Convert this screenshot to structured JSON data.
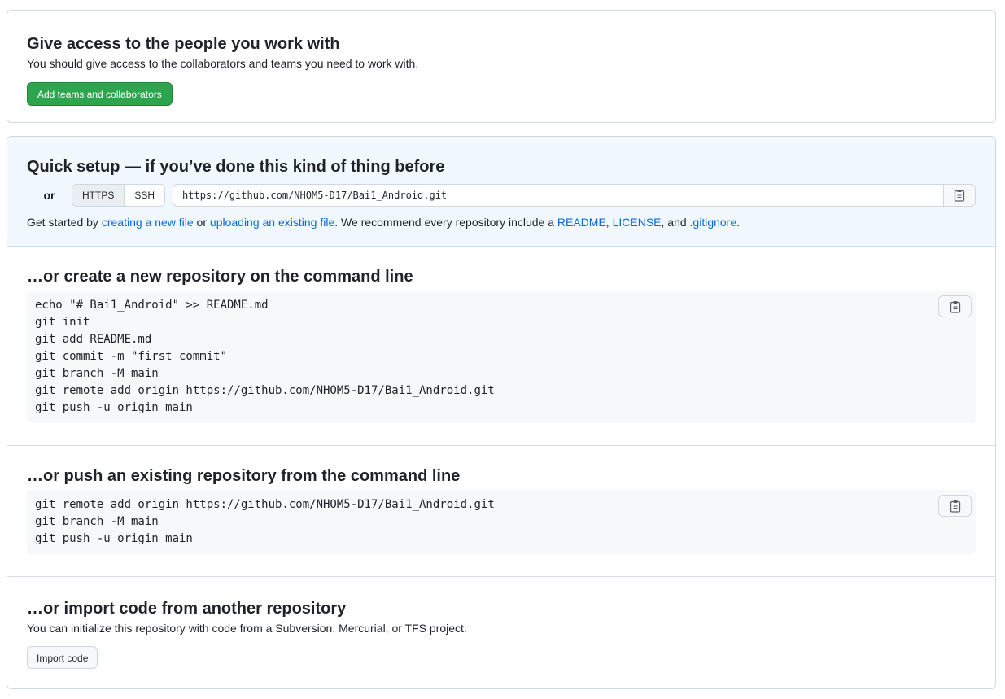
{
  "access": {
    "title": "Give access to the people you work with",
    "description": "You should give access to the collaborators and teams you need to work with.",
    "button_label": "Add teams and collaborators"
  },
  "quick_setup": {
    "title": "Quick setup — if you’ve done this kind of thing before",
    "or_label": "or",
    "protocols": [
      {
        "label": "HTTPS",
        "selected": true
      },
      {
        "label": "SSH",
        "selected": false
      }
    ],
    "clone_url": "https://github.com/NHOM5-D17/Bai1_Android.git",
    "copy_icon": "clipboard-icon",
    "get_started": {
      "prefix": "Get started by ",
      "link_new_file": "creating a new file",
      "or_text": " or ",
      "link_upload": "uploading an existing file",
      "middle": ". We recommend every repository include a ",
      "link_readme": "README",
      "comma": ", ",
      "link_license": "LICENSE",
      "and_text": ", and ",
      "link_gitignore": ".gitignore",
      "suffix": "."
    }
  },
  "create_repo": {
    "title": "…or create a new repository on the command line",
    "code": "echo \"# Bai1_Android\" >> README.md\ngit init\ngit add README.md\ngit commit -m \"first commit\"\ngit branch -M main\ngit remote add origin https://github.com/NHOM5-D17/Bai1_Android.git\ngit push -u origin main"
  },
  "push_repo": {
    "title": "…or push an existing repository from the command line",
    "code": "git remote add origin https://github.com/NHOM5-D17/Bai1_Android.git\ngit branch -M main\ngit push -u origin main"
  },
  "import_repo": {
    "title": "…or import code from another repository",
    "description": "You can initialize this repository with code from a Subversion, Mercurial, or TFS project.",
    "button_label": "Import code"
  },
  "colors": {
    "primary_green": "#2da44e",
    "link_blue": "#0969da",
    "quick_bg": "#f1f8ff"
  }
}
